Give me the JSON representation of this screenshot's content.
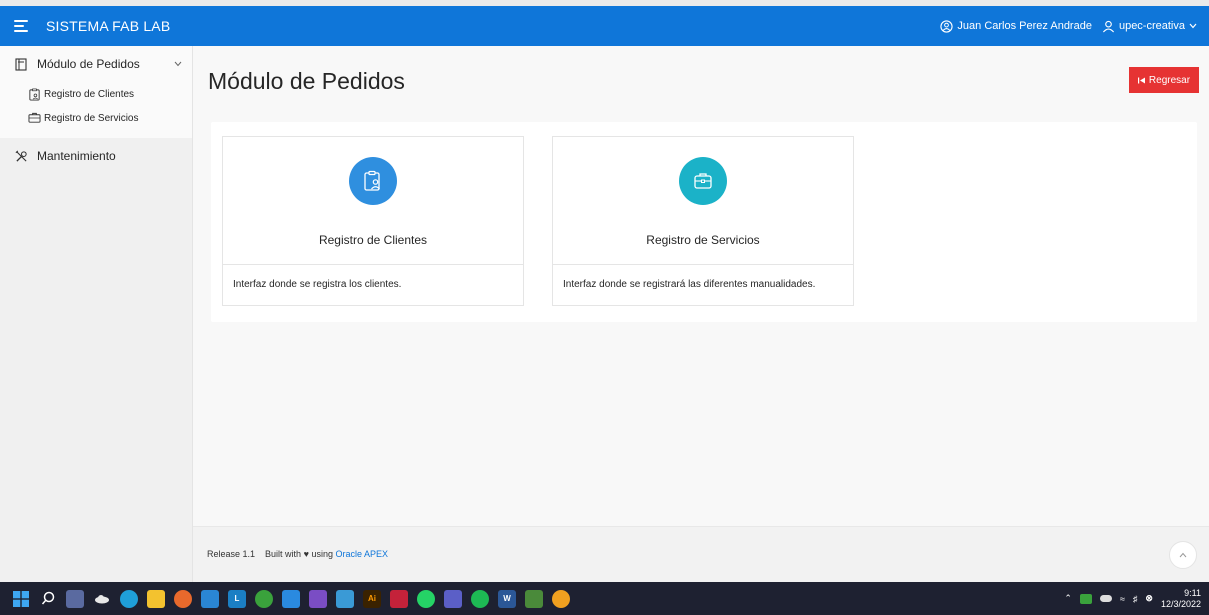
{
  "header": {
    "app_title": "SISTEMA FAB LAB",
    "user_name": "Juan Carlos Perez Andrade",
    "workspace": "upec-creativa",
    "color": "#0f76d9"
  },
  "sidebar": {
    "items": [
      {
        "label": "Módulo de Pedidos",
        "icon": "document-icon"
      },
      {
        "label": "Registro de Clientes",
        "icon": "clipboard-user-icon"
      },
      {
        "label": "Registro de Servicios",
        "icon": "briefcase-icon"
      },
      {
        "label": "Mantenimiento",
        "icon": "tools-icon"
      }
    ]
  },
  "page": {
    "title": "Módulo de Pedidos",
    "back_button": "Regresar",
    "back_color": "#e63333"
  },
  "cards": [
    {
      "title": "Registro de Clientes",
      "description": "Interfaz donde se registra los clientes.",
      "icon": "clipboard-user-icon",
      "color": "#2f8fdf"
    },
    {
      "title": "Registro de Servicios",
      "description": "Interfaz donde se registrará las diferentes manualidades.",
      "icon": "briefcase-icon",
      "color": "#1bb2c8"
    }
  ],
  "footer": {
    "release": "Release 1.1",
    "built_with": "Built with",
    "using": "using",
    "link": "Oracle APEX"
  },
  "taskbar": {
    "time": "9:11",
    "date": "12/3/2022"
  }
}
